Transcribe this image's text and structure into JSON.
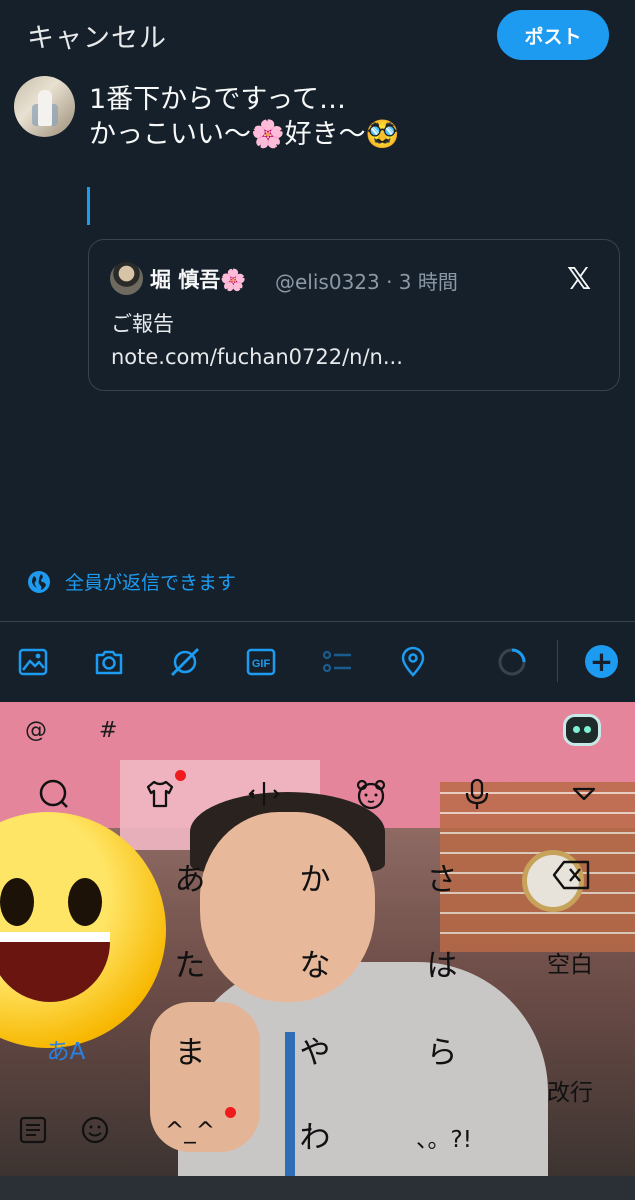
{
  "header": {
    "cancel_label": "キャンセル",
    "post_label": "ポスト"
  },
  "composer": {
    "text_line1": "1番下からですって…",
    "text_line2": "かっこいい〜🌸好き〜🥸"
  },
  "quote": {
    "name": "堀 慎吾🌸",
    "handle_time": "@elis0323 · 3 時間",
    "body_line1": "ご報告",
    "body_line2": "note.com/fuchan0722/n/n...",
    "x_logo": "𝕏"
  },
  "reply_setting": {
    "label": "全員が返信できます",
    "icon": "globe-icon"
  },
  "toolbar": {
    "icons": [
      "image-icon",
      "camera-icon",
      "grok-icon",
      "gif-icon",
      "poll-icon",
      "location-icon",
      "progress-ring-icon",
      "add-thread-icon"
    ],
    "gif_label": "GIF",
    "plus_label": "+"
  },
  "keyboard": {
    "top_symbols": [
      "@",
      "#"
    ],
    "row2_icons": [
      "search-icon",
      "shirt-icon",
      "cursor-move-icon",
      "bear-face-icon",
      "microphone-icon",
      "collapse-icon"
    ],
    "keys": {
      "a": "あ",
      "ka": "か",
      "sa": "さ",
      "ta": "た",
      "na": "な",
      "ha": "は",
      "ma": "ま",
      "ya": "や",
      "ra": "ら",
      "emoji_face": "^_^",
      "wa": "わ",
      "punct": "、。?!",
      "space": "空白",
      "enter": "改行",
      "mode": "あA"
    }
  }
}
